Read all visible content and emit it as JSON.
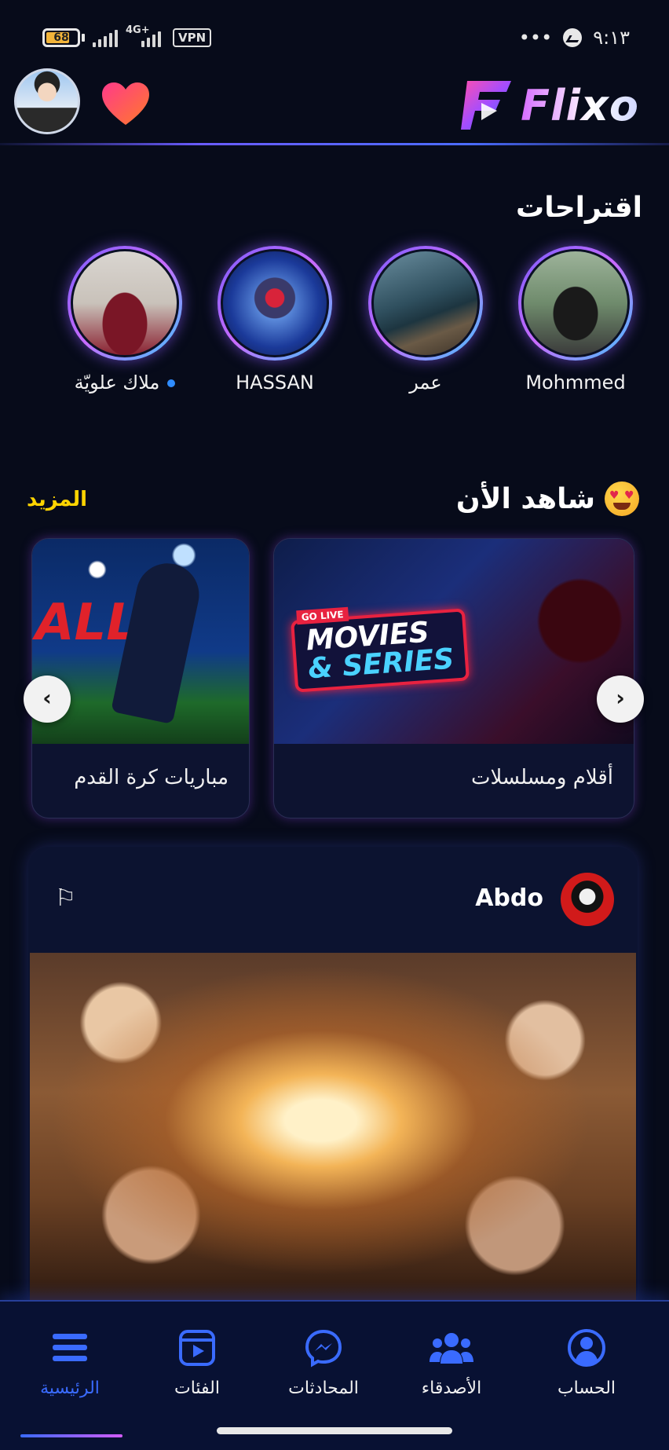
{
  "status_bar": {
    "battery": "68",
    "network": "4G+",
    "vpn": "VPN",
    "time": "٩:١٣",
    "dots": "•••"
  },
  "header": {
    "logo_text": "Flixo"
  },
  "suggestions": {
    "title": "اقتراحات",
    "items": [
      {
        "name": "Mohmmed"
      },
      {
        "name": "عمر"
      },
      {
        "name": "HASSAN"
      },
      {
        "name": "ملاك علويّة"
      }
    ]
  },
  "watch_now": {
    "title": "شاهد الأن",
    "more_label": "المزيد",
    "cards": [
      {
        "label": "أقلام ومسلسلات",
        "badge_top": "GO LIVE",
        "badge_line1": "MOVIES",
        "badge_line2": "& SERIES"
      },
      {
        "label": "مباريات كرة القدم",
        "side_text": "ALL"
      }
    ],
    "prev_icon": "‹",
    "next_icon": "›"
  },
  "post": {
    "author": "Abdo",
    "flag_icon": "⚐"
  },
  "bottom_nav": {
    "items": [
      {
        "label": "الرئيسية",
        "icon": "menu-icon"
      },
      {
        "label": "الفئات",
        "icon": "play-square-icon"
      },
      {
        "label": "المحادثات",
        "icon": "messenger-icon"
      },
      {
        "label": "الأصدقاء",
        "icon": "users-icon"
      },
      {
        "label": "الحساب",
        "icon": "user-circle-icon"
      }
    ],
    "active_index": 0
  },
  "colors": {
    "background": "#070b1a",
    "accent_blue": "#3a6bff",
    "more_yellow": "#ffd400",
    "ring_purple": "#c86bff"
  }
}
